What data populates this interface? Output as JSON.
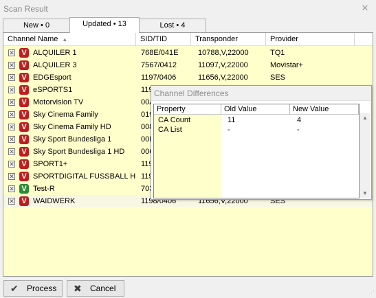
{
  "window": {
    "title": "Scan Result",
    "close_glyph": "✕"
  },
  "tabs": [
    {
      "label": "New",
      "count": "0"
    },
    {
      "label": "Updated",
      "count": "13"
    },
    {
      "label": "Lost",
      "count": "4"
    }
  ],
  "tab_bullet": "•",
  "columns": [
    "Channel Name",
    "SID/TID",
    "Transponder",
    "Provider"
  ],
  "sort_arrow": "▲",
  "checkbox_glyph": "✕",
  "rows": [
    {
      "name": "ALQUILER 1",
      "sid": "768E/041E",
      "transponder": "10788,V,22000",
      "provider": "TQ1",
      "icon": "V",
      "icon_color": "red"
    },
    {
      "name": "ALQUILER 3",
      "sid": "7567/0412",
      "transponder": "11097,V,22000",
      "provider": "Movistar+",
      "icon": "V",
      "icon_color": "red"
    },
    {
      "name": "EDGEsport",
      "sid": "1197/0406",
      "transponder": "11656,V,22000",
      "provider": "SES",
      "icon": "V",
      "icon_color": "red"
    },
    {
      "name": "eSPORTS1",
      "sid": "119",
      "transponder": "",
      "provider": "",
      "icon": "V",
      "icon_color": "red"
    },
    {
      "name": "Motorvision TV",
      "sid": "00A",
      "transponder": "",
      "provider": "",
      "icon": "V",
      "icon_color": "red"
    },
    {
      "name": "Sky Cinema Family",
      "sid": "019",
      "transponder": "",
      "provider": "",
      "icon": "V",
      "icon_color": "red"
    },
    {
      "name": "Sky Cinema Family HD",
      "sid": "008",
      "transponder": "",
      "provider": "",
      "icon": "V",
      "icon_color": "red"
    },
    {
      "name": "Sky Sport Bundesliga 1",
      "sid": "00D",
      "transponder": "",
      "provider": "",
      "icon": "V",
      "icon_color": "red"
    },
    {
      "name": "Sky Sport Bundesliga 1 HD",
      "sid": "006",
      "transponder": "",
      "provider": "",
      "icon": "V",
      "icon_color": "red"
    },
    {
      "name": "SPORT1+",
      "sid": "119",
      "transponder": "",
      "provider": "",
      "icon": "V",
      "icon_color": "red"
    },
    {
      "name": "SPORTDIGITAL FUSSBALL HD",
      "sid": "119",
      "transponder": "",
      "provider": "",
      "icon": "V",
      "icon_color": "red"
    },
    {
      "name": "Test-R",
      "sid": "703",
      "transponder": "",
      "provider": "",
      "icon": "V",
      "icon_color": "green"
    },
    {
      "name": "WAIDWERK",
      "sid": "1198/0406",
      "transponder": "11656,V,22000",
      "provider": "SES",
      "icon": "V",
      "icon_color": "red"
    }
  ],
  "differences": {
    "title": "Channel Differences",
    "columns": [
      "Property",
      "Old Value",
      "New Value"
    ],
    "rows": [
      {
        "property": "CA Count",
        "old": "11",
        "new": "4"
      },
      {
        "property": "CA List",
        "old": "-",
        "new": "-"
      }
    ]
  },
  "buttons": {
    "process": {
      "label": "Process",
      "icon": "check-icon",
      "glyph": "✔"
    },
    "cancel": {
      "label": "Cancel",
      "icon": "cancel-icon",
      "glyph": "✖"
    }
  },
  "colors": {
    "list_bg": "#ffffcc",
    "icon_red": "#c21d1d",
    "icon_green": "#2e8b35",
    "highlight_row": "#f7f7e4"
  }
}
